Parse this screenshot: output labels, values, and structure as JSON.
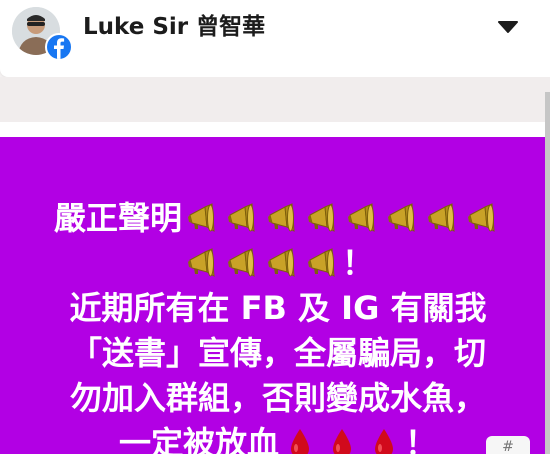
{
  "header": {
    "page_name": "Luke Sir 曾智華",
    "avatar_icon": "profile-photo",
    "badge_icon": "facebook-icon",
    "menu_icon": "caret-down-icon"
  },
  "post": {
    "background_color": "#b200e4",
    "text_color": "#ffffff",
    "line1": "嚴正聲明",
    "line1_icons": [
      "megaphone-icon",
      "megaphone-icon",
      "megaphone-icon",
      "megaphone-icon",
      "megaphone-icon",
      "megaphone-icon",
      "megaphone-icon",
      "megaphone-icon"
    ],
    "line2_icons": [
      "megaphone-icon",
      "megaphone-icon",
      "megaphone-icon",
      "megaphone-icon"
    ],
    "line2_end": "！",
    "line3": "近期所有在 FB 及 IG 有關我",
    "line4": "「送書」宣傳，全屬騙局，切",
    "line5": "勿加入群組，否則變成水魚，",
    "line6": "一定被放血",
    "line6_icons": [
      "blood-drop-icon",
      "blood-drop-icon",
      "blood-drop-icon"
    ],
    "line6_end": "！"
  },
  "corner_label": "#"
}
